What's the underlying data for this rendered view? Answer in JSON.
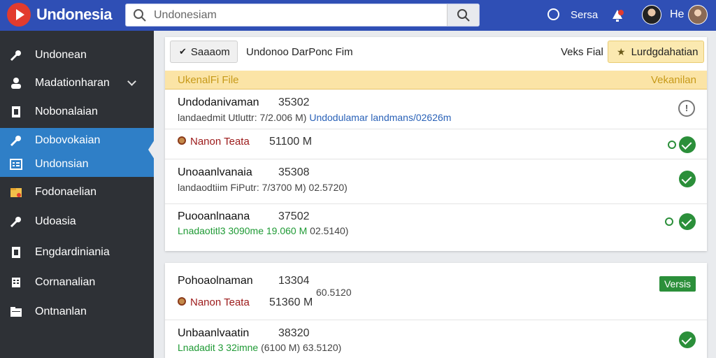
{
  "app": {
    "title": "Undonesia"
  },
  "search": {
    "placeholder": "Undonesiam",
    "value": "Undonesiam"
  },
  "header": {
    "user_text": "Sersa",
    "he_label": "He"
  },
  "sidebar": {
    "items": [
      {
        "label": "Undonean",
        "icon": "wrench-icon"
      },
      {
        "label": "Madationharan",
        "icon": "users-icon"
      },
      {
        "label": "Nobonalaian",
        "icon": "document-icon"
      },
      {
        "label": "Dobovokaian",
        "icon": "wrench-icon"
      },
      {
        "label": "Undonsian",
        "icon": "list-icon"
      },
      {
        "label": "Fodonaelian",
        "icon": "folder-icon"
      },
      {
        "label": "Udoasia",
        "icon": "wrench-icon"
      },
      {
        "label": "Engdardiniania",
        "icon": "document-icon"
      },
      {
        "label": "Cornanalian",
        "icon": "grid-icon"
      },
      {
        "label": "Ontnanlan",
        "icon": "folder-icon"
      }
    ]
  },
  "toolbar": {
    "search_button": "Saaaom",
    "title": "Undonoo DarPonc Fim",
    "view_label": "Veks Fial",
    "primary_button": "Lurdgdahatian"
  },
  "table": {
    "header_left": "UkenalFi File",
    "header_right": "Vekanilan"
  },
  "rows": [
    {
      "name": "Undodanivaman",
      "number": "35302",
      "meta_label": "landaedmit Utluttr:",
      "meta_size": "7/2.006 M)",
      "meta_link": "Undodulamar landmans/02626m",
      "status": "info"
    },
    {
      "sub_label": "Nanon Teata",
      "sub_size": "51100 M",
      "status": "check"
    },
    {
      "name": "Unoaanlvanaia",
      "number": "35308",
      "meta_label": "landaodtiim FiPutr:",
      "meta_size": "7/3700 M)",
      "meta_extra": "02.5720)",
      "status": "check"
    },
    {
      "name": "Puooanlnaana",
      "number": "37502",
      "meta_label": "Lnadaotitl3 3090me",
      "meta_size": "19.060 M",
      "meta_extra": "02.5140)",
      "status": "check"
    },
    {
      "name": "Pohoaolnaman",
      "number": "13304",
      "meta_extra": "60.5120",
      "sub_label": "Nanon Teata",
      "sub_size": "51360 M",
      "badge": "Versis"
    },
    {
      "name": "Unbaanlvaatin",
      "number": "38320",
      "meta_label": "Lnadadit 3 32imne",
      "meta_size": "(6100 M)",
      "meta_extra": "63.5120)",
      "status": "check"
    }
  ],
  "colors": {
    "header_bg": "#2f4fb5",
    "sidebar_bg": "#2e3136",
    "sidebar_active": "#2f7fc7",
    "table_header_bg": "#fbe4a6",
    "status_green": "#2b8f3a"
  }
}
